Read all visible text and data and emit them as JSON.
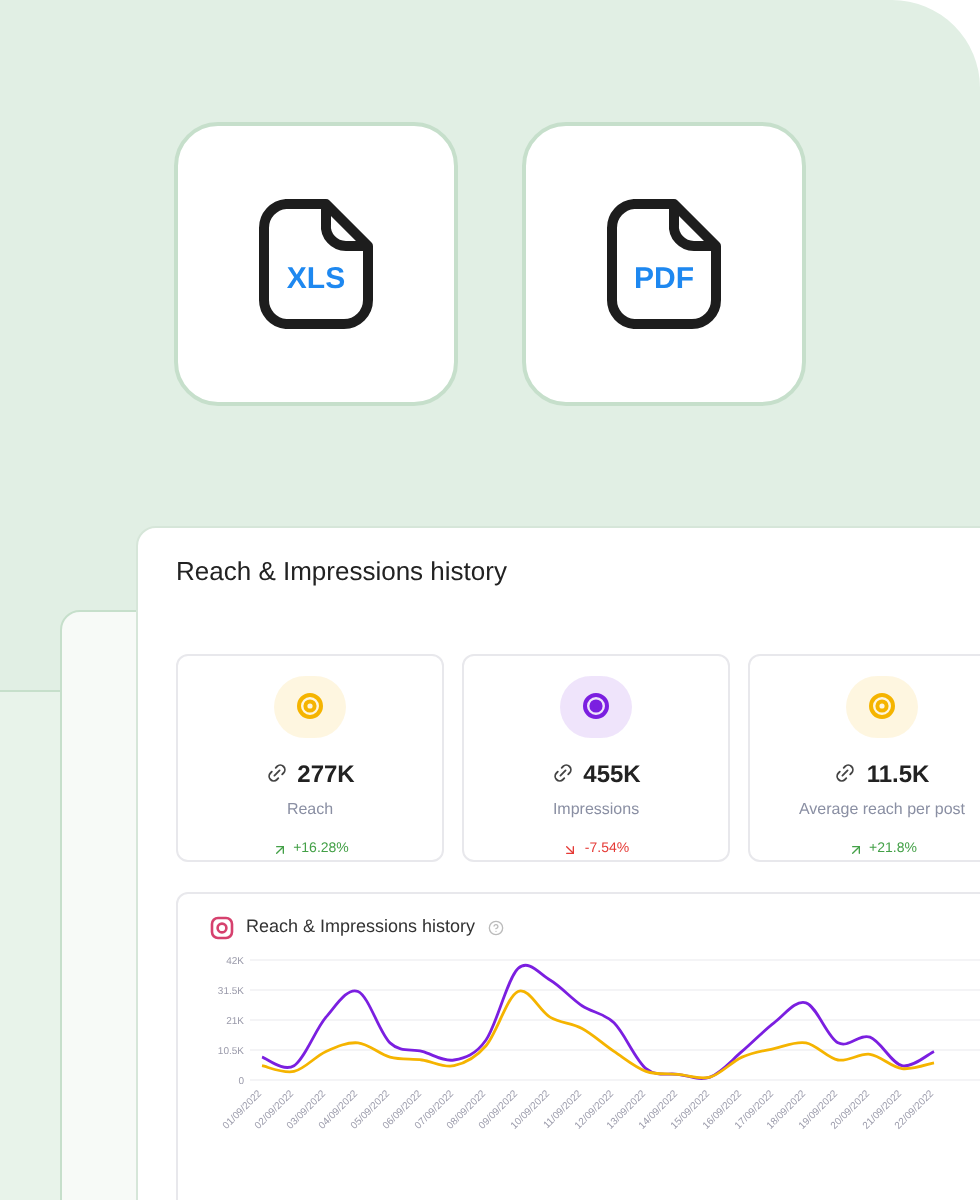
{
  "export_options": [
    {
      "label": "XLS"
    },
    {
      "label": "PDF"
    }
  ],
  "panel": {
    "title": "Reach & Impressions history",
    "stats": [
      {
        "value": "277K",
        "label": "Reach",
        "change": "+16.28%",
        "rising": true,
        "color": "#f5b400"
      },
      {
        "value": "455K",
        "label": "Impressions",
        "change": "-7.54%",
        "rising": false,
        "color": "#7b1fe0"
      },
      {
        "value": "11.5K",
        "label": "Average reach per post",
        "change": "+21.8%",
        "rising": true,
        "color": "#f5b400"
      }
    ],
    "chart_card": {
      "title": "Reach & Impressions history",
      "chart_data": {
        "type": "line",
        "grid": true,
        "categories": [
          "01/09/2022",
          "02/09/2022",
          "03/09/2022",
          "04/09/2022",
          "05/09/2022",
          "06/09/2022",
          "07/09/2022",
          "08/09/2022",
          "09/09/2022",
          "10/09/2022",
          "11/09/2022",
          "12/09/2022",
          "13/09/2022",
          "14/09/2022",
          "15/09/2022",
          "16/09/2022",
          "17/09/2022",
          "18/09/2022",
          "19/09/2022",
          "20/09/2022",
          "21/09/2022",
          "22/09/2022"
        ],
        "series": [
          {
            "color": "#7b1fe0",
            "values": [
              8000,
              5000,
              22000,
              31000,
              13000,
              10000,
              7000,
              14000,
              39000,
              35000,
              26000,
              20000,
              4000,
              2000,
              1000,
              10000,
              20000,
              27000,
              13000,
              15000,
              5000,
              10000
            ]
          },
          {
            "color": "#f5b400",
            "values": [
              5000,
              3000,
              10000,
              13000,
              8000,
              7000,
              5000,
              12000,
              31000,
              22000,
              18000,
              10000,
              3000,
              2000,
              1000,
              8000,
              11000,
              13000,
              7000,
              9000,
              4000,
              6000
            ]
          }
        ],
        "ylim": [
          0,
          42000
        ],
        "yticks": [
          {
            "value": 0,
            "label": "0"
          },
          {
            "value": 10500,
            "label": "10.5K"
          },
          {
            "value": 21000,
            "label": "21K"
          },
          {
            "value": 31500,
            "label": "31.5K"
          },
          {
            "value": 42000,
            "label": "42K"
          }
        ]
      }
    }
  }
}
